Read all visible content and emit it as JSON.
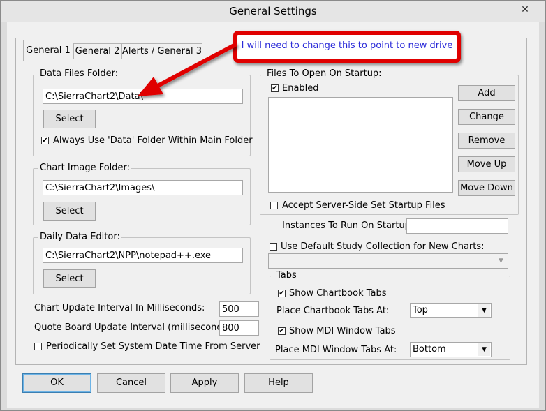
{
  "window": {
    "title": "General Settings",
    "close_glyph": "✕"
  },
  "tabs": [
    {
      "label": "General 1",
      "active": true
    },
    {
      "label": "General 2",
      "active": false
    },
    {
      "label": "Alerts / General 3",
      "active": false
    }
  ],
  "callout": {
    "text": "I will need to change this to point to new drive",
    "border_color": "#e00000",
    "text_color": "#2a2ad8"
  },
  "data_files": {
    "legend": "Data Files Folder:",
    "path": "C:\\SierraChart2\\Data\\",
    "select_label": "Select",
    "always_use_label": "Always Use 'Data' Folder Within Main Folder",
    "always_use_checked": true
  },
  "chart_image": {
    "legend": "Chart Image Folder:",
    "path": "C:\\SierraChart2\\Images\\",
    "select_label": "Select"
  },
  "daily_editor": {
    "legend": "Daily Data Editor:",
    "path": "C:\\SierraChart2\\NPP\\notepad++.exe",
    "select_label": "Select"
  },
  "chart_update": {
    "label": "Chart Update Interval In Milliseconds:",
    "value": "500"
  },
  "quote_update": {
    "label": "Quote Board Update Interval (milliseconds):",
    "value": "800"
  },
  "periodic_date": {
    "label": "Periodically Set System Date Time From Server",
    "checked": false
  },
  "startup_files": {
    "legend": "Files To Open On Startup:",
    "enabled_label": "Enabled",
    "enabled_checked": true,
    "buttons": {
      "add": "Add",
      "change": "Change",
      "remove": "Remove",
      "move_up": "Move Up",
      "move_down": "Move Down"
    },
    "accept_server_label": "Accept Server-Side Set Startup Files",
    "accept_server_checked": false
  },
  "instances": {
    "label": "Instances To Run On Startup:",
    "value": ""
  },
  "default_study": {
    "label": "Use Default Study Collection for New Charts:",
    "checked": false,
    "value": ""
  },
  "tabs_group": {
    "legend": "Tabs",
    "show_chartbook_label": "Show Chartbook Tabs",
    "show_chartbook_checked": true,
    "place_chartbook_label": "Place Chartbook Tabs At:",
    "place_chartbook_value": "Top",
    "show_mdi_label": "Show MDI Window Tabs",
    "show_mdi_checked": true,
    "place_mdi_label": "Place MDI Window Tabs At:",
    "place_mdi_value": "Bottom"
  },
  "footer": {
    "ok": "OK",
    "cancel": "Cancel",
    "apply": "Apply",
    "help": "Help"
  },
  "glyphs": {
    "check": "✔",
    "dropdown": "▼"
  }
}
